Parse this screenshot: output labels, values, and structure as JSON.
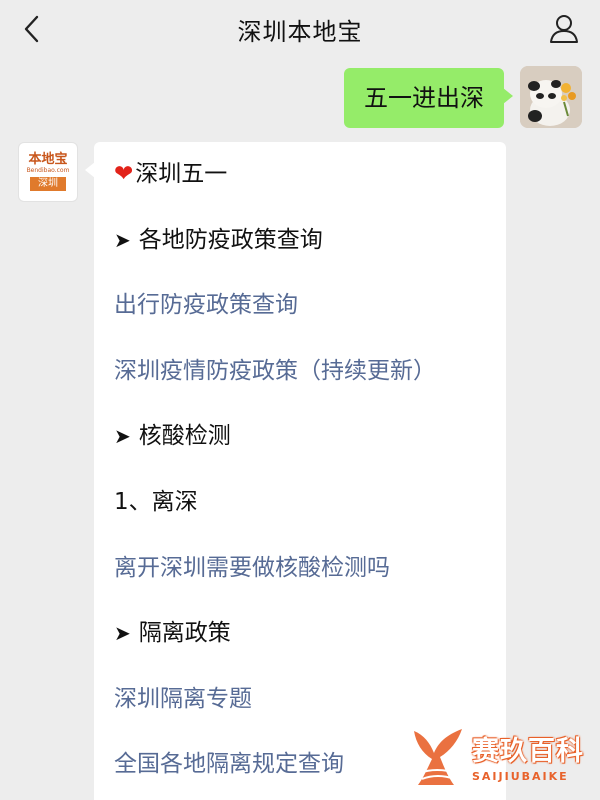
{
  "header": {
    "title": "深圳本地宝",
    "back_icon": "chevron-left-icon",
    "profile_icon": "person-icon"
  },
  "outgoing": {
    "text": "五一进出深"
  },
  "bot_avatar": {
    "brand": "本地宝",
    "url": "Bendibao.com",
    "city": "深圳"
  },
  "reply": {
    "lines": [
      {
        "kind": "heading",
        "icon": "heart",
        "text": "深圳五一"
      },
      {
        "kind": "section",
        "icon": "arrow",
        "text": "各地防疫政策查询"
      },
      {
        "kind": "link",
        "text": "出行防疫政策查询"
      },
      {
        "kind": "link",
        "text": "深圳疫情防疫政策（持续更新）"
      },
      {
        "kind": "section",
        "icon": "arrow",
        "text": "核酸检测"
      },
      {
        "kind": "text",
        "text": "1、离深"
      },
      {
        "kind": "link",
        "text": "离开深圳需要做核酸检测吗"
      },
      {
        "kind": "section",
        "icon": "arrow",
        "text": "隔离政策"
      },
      {
        "kind": "link",
        "text": "深圳隔离专题"
      },
      {
        "kind": "link",
        "text": "全国各地隔离规定查询"
      }
    ]
  },
  "watermark": {
    "cn": "赛玖百科",
    "en": "SAIJIUBAIKE"
  },
  "colors": {
    "background": "#ededed",
    "outgoing_bubble": "#95ec69",
    "link": "#576b95",
    "heart": "#e2231a",
    "watermark": "#e8622b"
  }
}
